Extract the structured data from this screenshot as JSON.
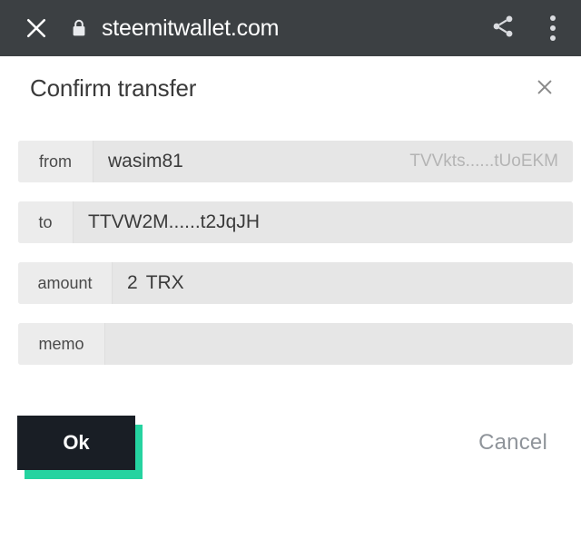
{
  "browser": {
    "close_icon": "close-icon",
    "lock_icon": "lock-icon",
    "url": "steemitwallet.com",
    "share_icon": "share-icon",
    "overflow_icon": "more-vertical-icon",
    "bar_color": "#3c4043"
  },
  "dialog": {
    "title": "Confirm transfer",
    "close_icon": "close-icon",
    "fields": [
      {
        "label": "from",
        "value": "wasim81",
        "secondary": "TVVkts......tUoEKM"
      },
      {
        "label": "to",
        "value": "TTVW2M......t2JqJH",
        "secondary": ""
      },
      {
        "label": "amount",
        "value": "2",
        "unit": "TRX",
        "secondary": ""
      },
      {
        "label": "memo",
        "value": "",
        "secondary": ""
      }
    ],
    "actions": {
      "ok_label": "Ok",
      "cancel_label": "Cancel",
      "ok_color": "#191e25",
      "ok_shadow_color": "#25d3a0",
      "cancel_color": "#8f949a"
    }
  }
}
